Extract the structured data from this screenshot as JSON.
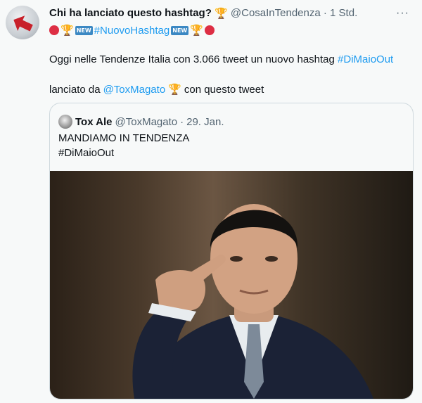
{
  "tweet": {
    "author_name": "Chi ha lanciato questo hashtag?",
    "handle": "@CosaInTendenza",
    "time": "1 Std.",
    "more_icon": "more-dots-icon",
    "hashtag_line": "#NuovoHashtag",
    "body_line1_prefix": "Oggi nelle Tendenze Italia con 3.066 tweet un nuovo hashtag ",
    "body_line1_hashtag": "#DiMaioOut",
    "body_line2_prefix": "lanciato da",
    "body_line2_mention": "@ToxMagato",
    "body_line2_suffix": "con questo tweet",
    "emoji": {
      "trophy": "🏆",
      "new_badge": "NEW"
    }
  },
  "quoted": {
    "name": "Tox Ale",
    "handle": "@ToxMagato",
    "date": "29. Jan.",
    "text_line1": "MANDIAMO IN TENDENZA",
    "text_line2": "#DiMaioOut"
  },
  "colors": {
    "link": "#1d9bf0",
    "muted": "#536471",
    "background": "#f7f9f9",
    "border": "#cfd9de"
  }
}
